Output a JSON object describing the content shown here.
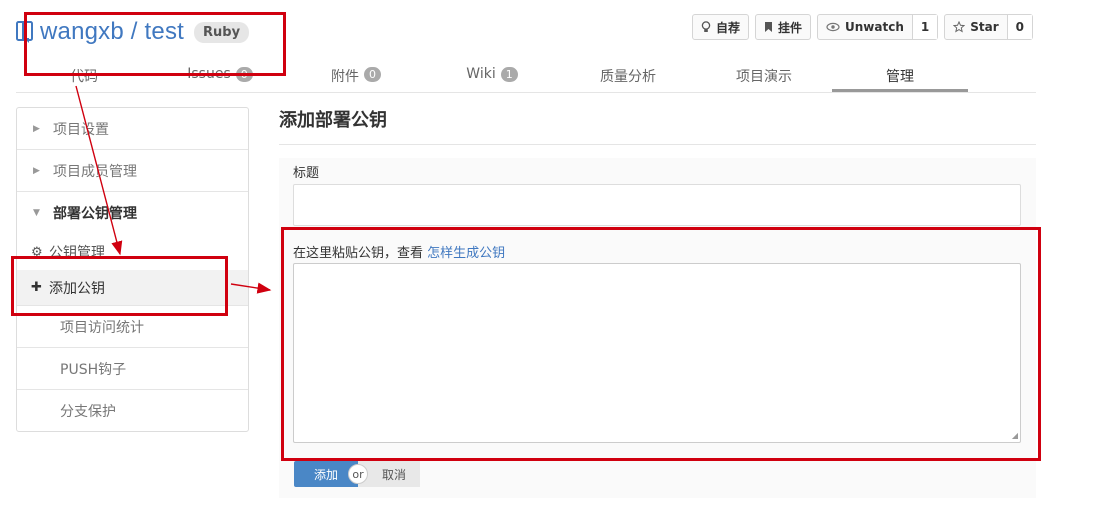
{
  "header": {
    "repo_name": "wangxb / test",
    "language_badge": "Ruby",
    "actions": {
      "recommend_label": "自荐",
      "pin_label": "挂件",
      "watch_label": "Unwatch",
      "watch_count": "1",
      "star_label": "Star",
      "star_count": "0"
    }
  },
  "tabs": [
    {
      "label": "代码",
      "badge": ""
    },
    {
      "label": "Issues",
      "badge": "0"
    },
    {
      "label": "附件",
      "badge": "0"
    },
    {
      "label": "Wiki",
      "badge": "1"
    },
    {
      "label": "质量分析",
      "badge": ""
    },
    {
      "label": "项目演示",
      "badge": ""
    },
    {
      "label": "管理",
      "badge": "",
      "active": true
    }
  ],
  "sidebar": {
    "items": [
      {
        "label": "项目设置"
      },
      {
        "label": "项目成员管理"
      },
      {
        "label": "部署公钥管理"
      },
      {
        "label": "公钥管理"
      },
      {
        "label": "添加公钥"
      },
      {
        "label": "项目访问统计"
      },
      {
        "label": "PUSH钩子"
      },
      {
        "label": "分支保护"
      }
    ]
  },
  "main": {
    "title": "添加部署公钥",
    "title_field_label": "标题",
    "title_field_value": "",
    "key_label_prefix": "在这里粘贴公钥，查看",
    "key_label_link": "怎样生成公钥",
    "key_value": "",
    "submit_label": "添加",
    "or_label": "or",
    "cancel_label": "取消"
  },
  "colors": {
    "link": "#4078c0",
    "primary_button": "#4a87c6",
    "annotation": "#d0000f"
  }
}
